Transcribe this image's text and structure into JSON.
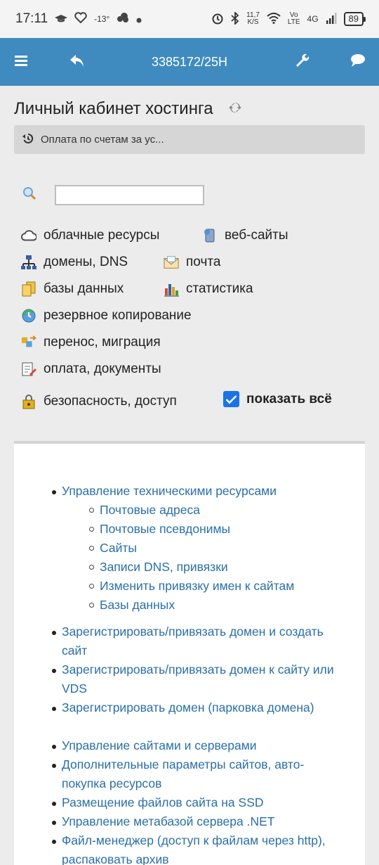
{
  "status_bar": {
    "time": "17:11",
    "temperature": "-13°",
    "net_speed_top": "11,7",
    "net_speed_bottom": "K/S",
    "volte_top": "Vo",
    "volte_bottom": "LTE",
    "network": "4G",
    "battery": "89"
  },
  "toolbar": {
    "title": "3385172/25H"
  },
  "page": {
    "title": "Личный кабинет хостинга",
    "notice": "Оплата по счетам за ус..."
  },
  "categories": [
    {
      "label": "облачные ресурсы",
      "icon": "cloud-icon"
    },
    {
      "label": "веб-сайты",
      "icon": "server-icon"
    },
    {
      "label": "домены, DNS",
      "icon": "network-icon"
    },
    {
      "label": "почта",
      "icon": "mail-icon"
    },
    {
      "label": "базы данных",
      "icon": "database-icon"
    },
    {
      "label": "статистика",
      "icon": "chart-icon"
    },
    {
      "label": "резервное копирование",
      "icon": "backup-icon"
    },
    {
      "label": "перенос, миграция",
      "icon": "migration-icon"
    },
    {
      "label": "оплата, документы",
      "icon": "document-icon"
    },
    {
      "label": "безопасность, доступ",
      "icon": "lock-icon"
    }
  ],
  "show_all": {
    "label": "показать всё",
    "checked": true
  },
  "links": {
    "g1_main": "Управление техническими ресурсами",
    "g1_sub": [
      "Почтовые адреса",
      "Почтовые псевдонимы",
      "Сайты",
      "Записи DNS, привязки",
      "Изменить привязку имен к сайтам",
      "Базы данных"
    ],
    "g2": [
      "Зарегистрировать/привязать домен и создать сайт",
      "Зарегистрировать/привязать домен к сайту или VDS",
      "Зарегистрировать домен (парковка домена)"
    ],
    "g3": [
      "Управление сайтами и серверами",
      "Дополнительные параметры сайтов, авто-покупка ресурсов",
      "Размещение файлов сайта на SSD",
      "Управление метабазой сервера .NET",
      "Файл-менеджер (доступ к файлам через http), распаковать архив"
    ]
  },
  "colors": {
    "toolbar_bg": "#3f8bbf",
    "link": "#2a6fa8",
    "checkbox": "#1a73e8"
  }
}
